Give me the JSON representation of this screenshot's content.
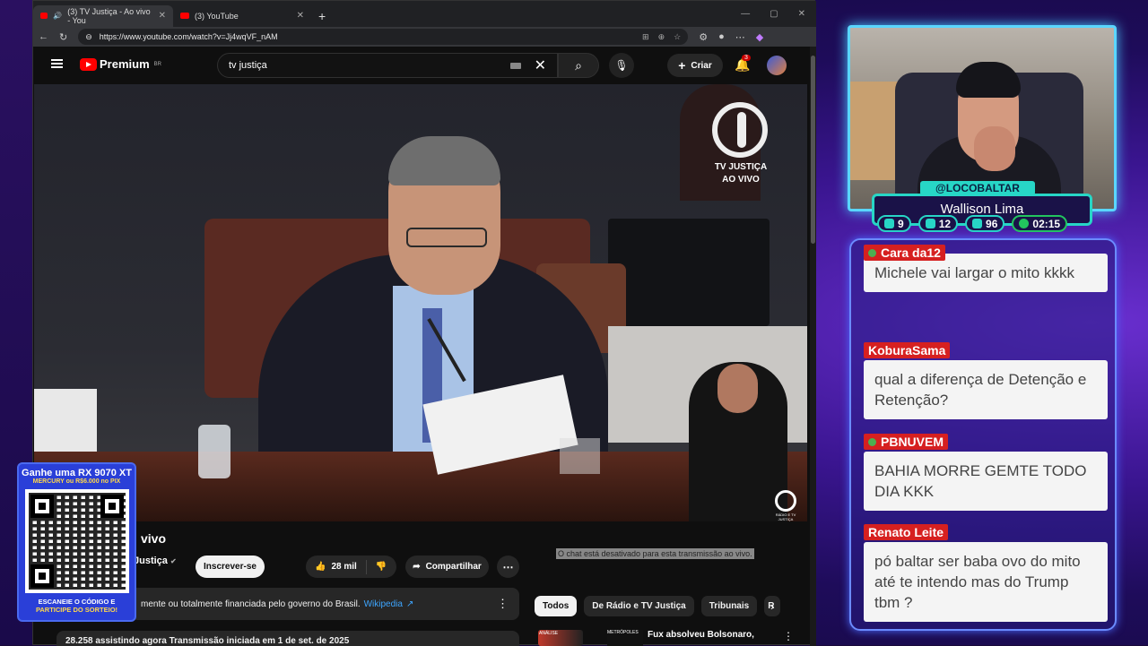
{
  "browser": {
    "tabs": [
      {
        "label": "(3) TV Justiça - Ao vivo - You",
        "active": true
      },
      {
        "label": "(3) YouTube",
        "active": false
      }
    ],
    "new_tab": "+",
    "url": "https://www.youtube.com/watch?v=Jj4wqVF_nAM"
  },
  "youtube": {
    "logo": "Premium",
    "region": "BR",
    "search_value": "tv justiça",
    "create_label": "Criar",
    "notif_count": "3",
    "video": {
      "watermark_line1": "TV JUSTIÇA",
      "watermark_line2": "AO VIVO",
      "small_wm": "RÁDIO E TV JUSTIÇA"
    },
    "title": "vivo",
    "channel": "Justiça",
    "subscribe": "Inscrever-se",
    "likes": "28 mil",
    "share": "Compartilhar",
    "chat_disabled": "O chat está desativado para esta transmissão ao vivo.",
    "info_text": "mente ou totalmente financiada pelo governo do Brasil.",
    "info_link": "Wikipedia",
    "stats": "28.258 assistindo agora  Transmissão iniciada em 1 de set. de 2025",
    "chips": [
      "Todos",
      "De Rádio e TV Justiça",
      "Tribunais",
      "R"
    ],
    "rec_title": "Fux absolveu Bolsonaro,",
    "rec_badge": "ANÁLISE",
    "rec_source": "METRÓPOLES"
  },
  "promo": {
    "line1": "Ganhe uma RX 9070 XT",
    "line2": "MERCURY ou R$6.000 no PIX",
    "line3": "ESCANEIE O CÓDIGO E",
    "line4": "PARTICIPE DO SORTEIO!"
  },
  "stream": {
    "handle": "@LOCOBALTAR",
    "name": "Wallison Lima",
    "counters": [
      {
        "icon": "twitch-icon",
        "value": "9"
      },
      {
        "icon": "youtube-icon",
        "value": "12"
      },
      {
        "icon": "kick-icon",
        "value": "96"
      },
      {
        "icon": "clock-icon",
        "value": "02:15"
      }
    ]
  },
  "chat": [
    {
      "user": "Cara da12",
      "text": "Michele vai largar o mito kkkk",
      "badge": true
    },
    {
      "user": "KoburaSama",
      "text": "qual a diferença de Detenção e Retenção?",
      "badge": false
    },
    {
      "user": "PBNUVEM",
      "text": "BAHIA MORRE GEMTE TODO DIA KKK",
      "badge": true
    },
    {
      "user": "Renato Leite",
      "text": "pó baltar ser baba ovo do mito até te intendo mas do Trump tbm ?",
      "badge": false
    }
  ],
  "colors": {
    "accent_cyan": "#27d6c6",
    "chat_user": "#d62020",
    "yt_red": "#ff0000"
  }
}
